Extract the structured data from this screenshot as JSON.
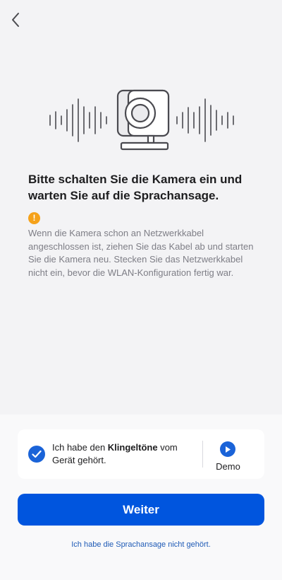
{
  "header": {
    "back_icon": "chevron-left-icon"
  },
  "illustration": {
    "icon": "camera-sound-waves-icon"
  },
  "main": {
    "title": "Bitte schalten Sie die Kamera ein und warten Sie auf die Sprachansage.",
    "warning_icon": "!",
    "notice": "Wenn die Kamera schon an Netzwerkkabel angeschlossen ist, ziehen Sie das Kabel ab und starten Sie die Kamera neu. Stecken Sie das Netzwerkkabel nicht ein, bevor die WLAN-Konfiguration fertig war."
  },
  "confirm": {
    "checked": true,
    "text_before": "Ich habe den ",
    "text_bold": "Klingeltöne",
    "text_after": " vom Gerät gehört.",
    "demo_label": "Demo"
  },
  "actions": {
    "continue_label": "Weiter",
    "not_heard_label": "Ich habe die Sprachansage nicht gehört."
  },
  "colors": {
    "accent": "#0055de",
    "check": "#1a63d8",
    "warning": "#f5a21b",
    "link": "#1f5bb6"
  }
}
